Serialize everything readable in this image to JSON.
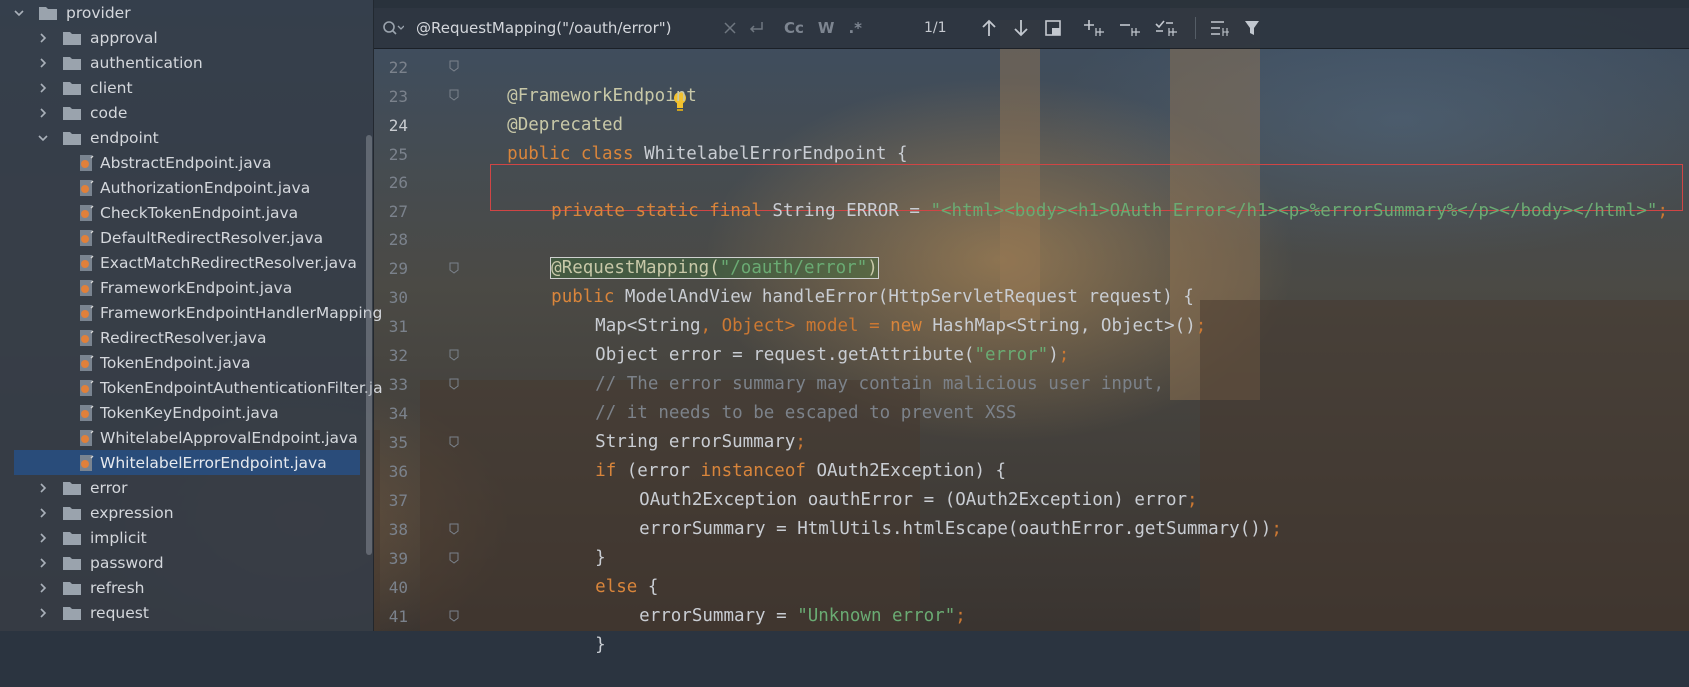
{
  "sidebar": {
    "items": [
      {
        "label": "provider",
        "type": "folder",
        "expanded": true
      },
      {
        "label": "approval",
        "type": "folder"
      },
      {
        "label": "authentication",
        "type": "folder"
      },
      {
        "label": "client",
        "type": "folder"
      },
      {
        "label": "code",
        "type": "folder"
      },
      {
        "label": "endpoint",
        "type": "folder",
        "expanded": true
      },
      {
        "label": "AbstractEndpoint.java",
        "type": "java"
      },
      {
        "label": "AuthorizationEndpoint.java",
        "type": "java"
      },
      {
        "label": "CheckTokenEndpoint.java",
        "type": "java"
      },
      {
        "label": "DefaultRedirectResolver.java",
        "type": "java"
      },
      {
        "label": "ExactMatchRedirectResolver.java",
        "type": "java"
      },
      {
        "label": "FrameworkEndpoint.java",
        "type": "java"
      },
      {
        "label": "FrameworkEndpointHandlerMapping",
        "type": "java"
      },
      {
        "label": "RedirectResolver.java",
        "type": "java"
      },
      {
        "label": "TokenEndpoint.java",
        "type": "java"
      },
      {
        "label": "TokenEndpointAuthenticationFilter.ja",
        "type": "java"
      },
      {
        "label": "TokenKeyEndpoint.java",
        "type": "java"
      },
      {
        "label": "WhitelabelApprovalEndpoint.java",
        "type": "java"
      },
      {
        "label": "WhitelabelErrorEndpoint.java",
        "type": "java",
        "selected": true
      },
      {
        "label": "error",
        "type": "folder"
      },
      {
        "label": "expression",
        "type": "folder"
      },
      {
        "label": "implicit",
        "type": "folder"
      },
      {
        "label": "password",
        "type": "folder"
      },
      {
        "label": "refresh",
        "type": "folder"
      },
      {
        "label": "request",
        "type": "folder"
      }
    ]
  },
  "search": {
    "query": "@RequestMapping(\"/oauth/error\")",
    "match_case_label": "Cc",
    "words_label": "W",
    "regex_label": ".*",
    "match_count": "1/1"
  },
  "editor": {
    "line_numbers": [
      "22",
      "23",
      "24",
      "25",
      "26",
      "27",
      "28",
      "29",
      "30",
      "31",
      "32",
      "33",
      "34",
      "35",
      "36",
      "37",
      "38",
      "39",
      "40",
      "41"
    ],
    "lines": {
      "l22": "@FrameworkEndpoint",
      "l23": "@Deprecated",
      "l24_kw": "public class ",
      "l24_rest": "WhitelabelErrorEndpoint {",
      "l26_kw": "private static final ",
      "l26_mid": "String ERROR = ",
      "l26_str": "\"<html><body><h1>OAuth Error</h1><p>%errorSummary%</p></body></html>\"",
      "l26_end": ";",
      "l28_ann": "@RequestMapping(",
      "l28_str": "\"/oauth/error\"",
      "l28_end": ")",
      "l29_kw": "public ",
      "l29_rest": "ModelAndView handleError(HttpServletRequest request) {",
      "l30_a": "Map<String",
      "l30_b": ", Object> model = ",
      "l30_kw": "new ",
      "l30_c": "HashMap<String",
      "l30_d": ", Object>()",
      "l30_e": ";",
      "l31_a": "Object error = request.getAttribute(",
      "l31_str": "\"error\"",
      "l31_b": ")",
      "l31_c": ";",
      "l32": "// The error summary may contain malicious user input,",
      "l33": "// it needs to be escaped to prevent XSS",
      "l34_a": "String errorSummary",
      "l34_b": ";",
      "l35_kw": "if ",
      "l35_a": "(error ",
      "l35_kw2": "instanceof ",
      "l35_b": "OAuth2Exception) {",
      "l36_a": "OAuth2Exception oauthError = (OAuth2Exception) error",
      "l36_b": ";",
      "l37_a": "errorSummary = HtmlUtils.htmlEscape(oauthError.getSummary())",
      "l37_b": ";",
      "l38": "}",
      "l39_kw": "else ",
      "l39_a": "{",
      "l40_a": "errorSummary = ",
      "l40_str": "\"Unknown error\"",
      "l40_b": ";",
      "l41": "}"
    }
  }
}
